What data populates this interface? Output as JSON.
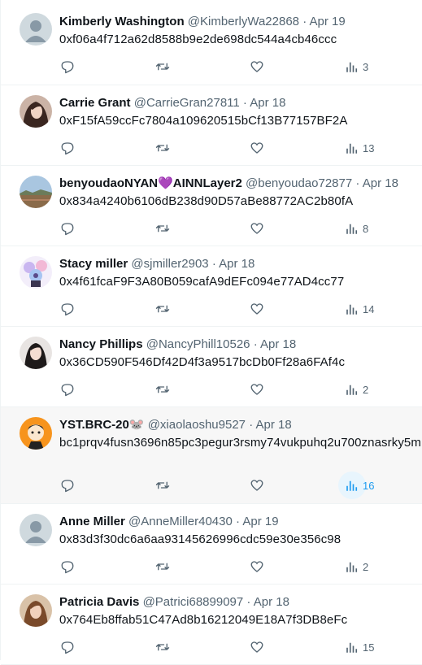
{
  "feed": {
    "tweets": [
      {
        "name": "Kimberly Washington",
        "handle": "@KimberlyWa22868",
        "dot": "·",
        "date": "Apr 19",
        "text": "0xf06a4f712a62d8588b9e2de698dc544a4cb46ccc",
        "views": "3",
        "avatar": "default-avatar"
      },
      {
        "name": "Carrie Grant",
        "handle": "@CarrieGran27811",
        "dot": "·",
        "date": "Apr 18",
        "text": "0xF15fA59ccFc7804a109620515bCf13B77157BF2A",
        "views": "13",
        "avatar": "profile-photo"
      },
      {
        "name": "benyoudaoNYAN💜AINNLayer2",
        "handle": "@benyoudao72877",
        "dot": "·",
        "date": "Apr 18",
        "text": "0x834a4240b6106dB238d90D57aBe88772AC2b80fA",
        "views": "8",
        "avatar": "landscape-photo"
      },
      {
        "name": "Stacy miller",
        "handle": "@sjmiller2903",
        "dot": "·",
        "date": "Apr 18",
        "text": "0x4f61fcaF9F3A80B059cafA9dEFc094e77AD4cc77",
        "views": "14",
        "avatar": "flower-illustration"
      },
      {
        "name": "Nancy Phillips",
        "handle": "@NancyPhill10526",
        "dot": "·",
        "date": "Apr 18",
        "text": "0x36CD590F546Df42D4f3a9517bcDb0Ff28a6FAf4c",
        "views": "2",
        "avatar": "profile-photo"
      },
      {
        "name": "YST.BRC-20🐭",
        "handle": "@xiaolaoshu9527",
        "dot": "·",
        "date": "Apr 18",
        "text": "bc1prqv4fusn3696n85pc3pegur3rsmy74vukpuhq2u700znasrky5m",
        "views": "16",
        "avatar": "cartoon-avatar"
      },
      {
        "name": "Anne Miller",
        "handle": "@AnneMiller40430",
        "dot": "·",
        "date": "Apr 19",
        "text": "0x83d3f30dc6a6aa93145626996cdc59e30e356c98",
        "views": "2",
        "avatar": "default-avatar"
      },
      {
        "name": "Patricia Davis",
        "handle": "@Patrici68899097",
        "dot": "·",
        "date": "Apr 18",
        "text": "0x764Eb8ffab51C47Ad8b16212049E18A7f3DB8eFc",
        "views": "15",
        "avatar": "profile-photo"
      }
    ]
  },
  "colors": {
    "accent": "#1d9bf0",
    "muted": "#536471",
    "text": "#0f1419",
    "divider": "#eff3f4",
    "hover_bg": "#f7f7f7"
  }
}
